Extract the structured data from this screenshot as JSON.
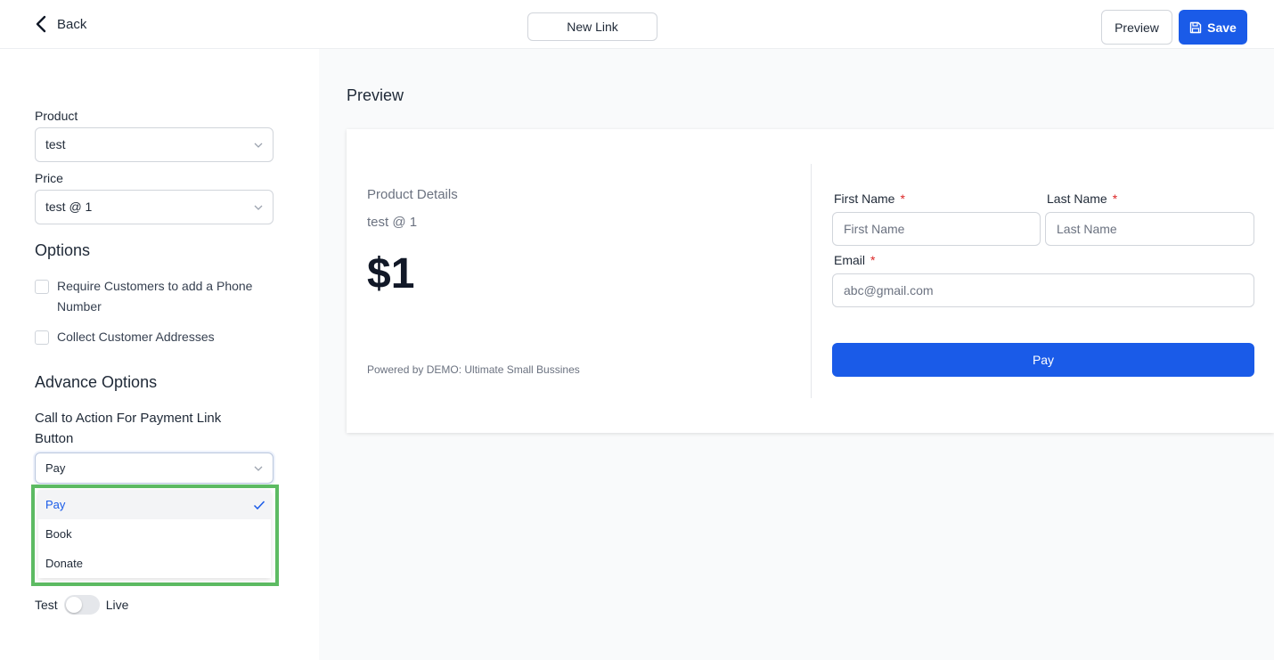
{
  "header": {
    "back_label": "Back",
    "link_name": "New Link",
    "preview_label": "Preview",
    "save_label": "Save"
  },
  "form": {
    "product_label": "Product",
    "product_value": "test",
    "price_label": "Price",
    "price_value": "test @ 1",
    "options_heading": "Options",
    "options": [
      {
        "label": "Require Customers to add a Phone Number",
        "checked": false
      },
      {
        "label": "Collect Customer Addresses",
        "checked": false
      }
    ],
    "advance_heading": "Advance Options",
    "cta_label": "Call to Action For Payment Link Button",
    "cta_value": "Pay",
    "cta_options": [
      {
        "label": "Pay",
        "selected": true
      },
      {
        "label": "Book",
        "selected": false
      },
      {
        "label": "Donate",
        "selected": false
      }
    ],
    "mode": {
      "left": "Test",
      "right": "Live",
      "on": false
    }
  },
  "preview": {
    "title": "Preview",
    "product_details_label": "Product Details",
    "product_sub": "test @ 1",
    "price": "$1",
    "powered_by": "Powered by DEMO: Ultimate Small Bussines",
    "first_name_label": "First Name",
    "first_name_placeholder": "First Name",
    "last_name_label": "Last Name",
    "last_name_placeholder": "Last Name",
    "email_label": "Email",
    "email_placeholder": "abc@gmail.com",
    "required_mark": "*",
    "pay_button": "Pay"
  },
  "colors": {
    "primary": "#1a5be8",
    "highlight_frame": "#5dbb63",
    "required": "#dc2626"
  }
}
